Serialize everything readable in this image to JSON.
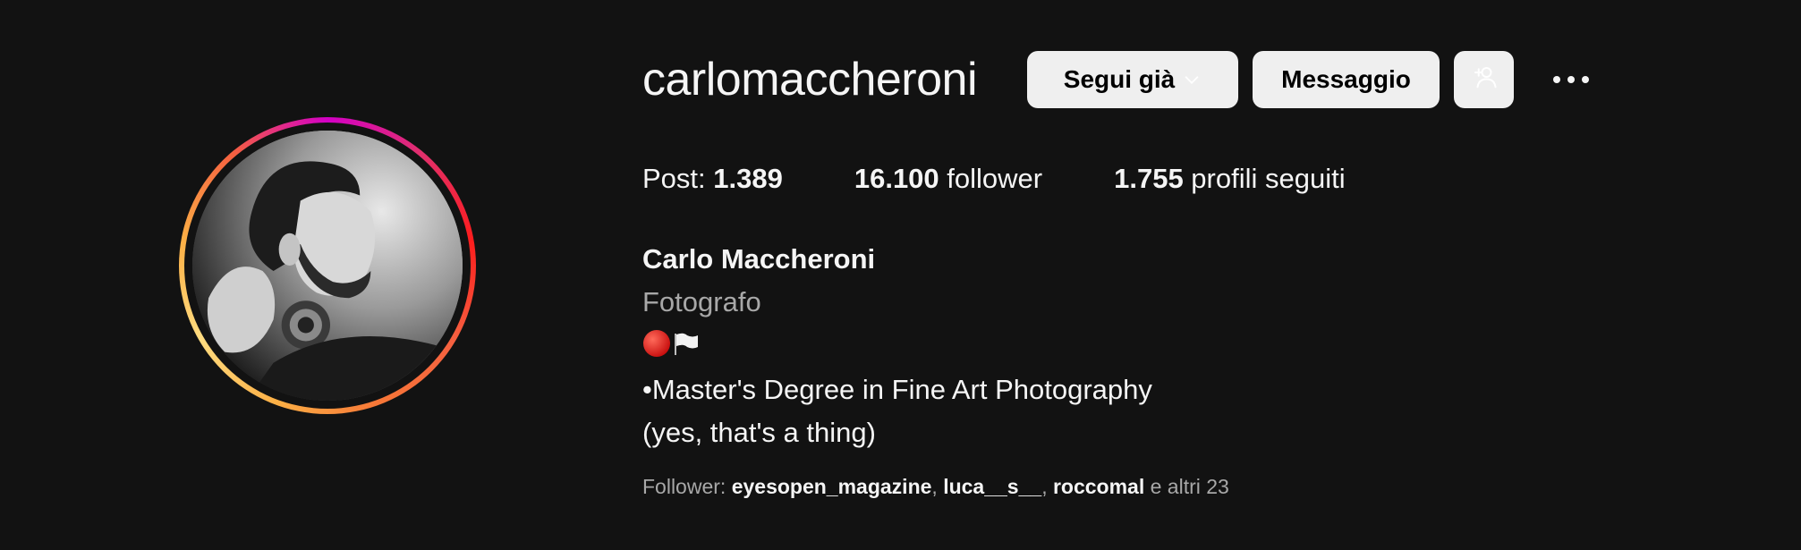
{
  "profile": {
    "username": "carlomaccheroni",
    "full_name": "Carlo Maccheroni",
    "category": "Fotografo",
    "bio_emoji": [
      "red-circle",
      "white-flag"
    ],
    "bio_line1": "•Master's Degree in Fine Art Photography",
    "bio_line2": "(yes, that's a thing)"
  },
  "actions": {
    "follow_label": "Segui già",
    "message_label": "Messaggio"
  },
  "stats": {
    "posts_label": "Post: ",
    "posts_value": "1.389",
    "followers_value": "16.100",
    "followers_label": " follower",
    "following_value": "1.755",
    "following_label": " profili seguiti"
  },
  "followed_by": {
    "prefix": "Follower: ",
    "accounts": [
      "eyesopen_magazine",
      "luca__s__",
      "roccomal"
    ],
    "sep1": ", ",
    "sep2": ", ",
    "suffix": " e altri 23"
  },
  "colors": {
    "background": "#121212",
    "button_bg": "#efefef",
    "secondary_text": "#a8a8a8"
  }
}
